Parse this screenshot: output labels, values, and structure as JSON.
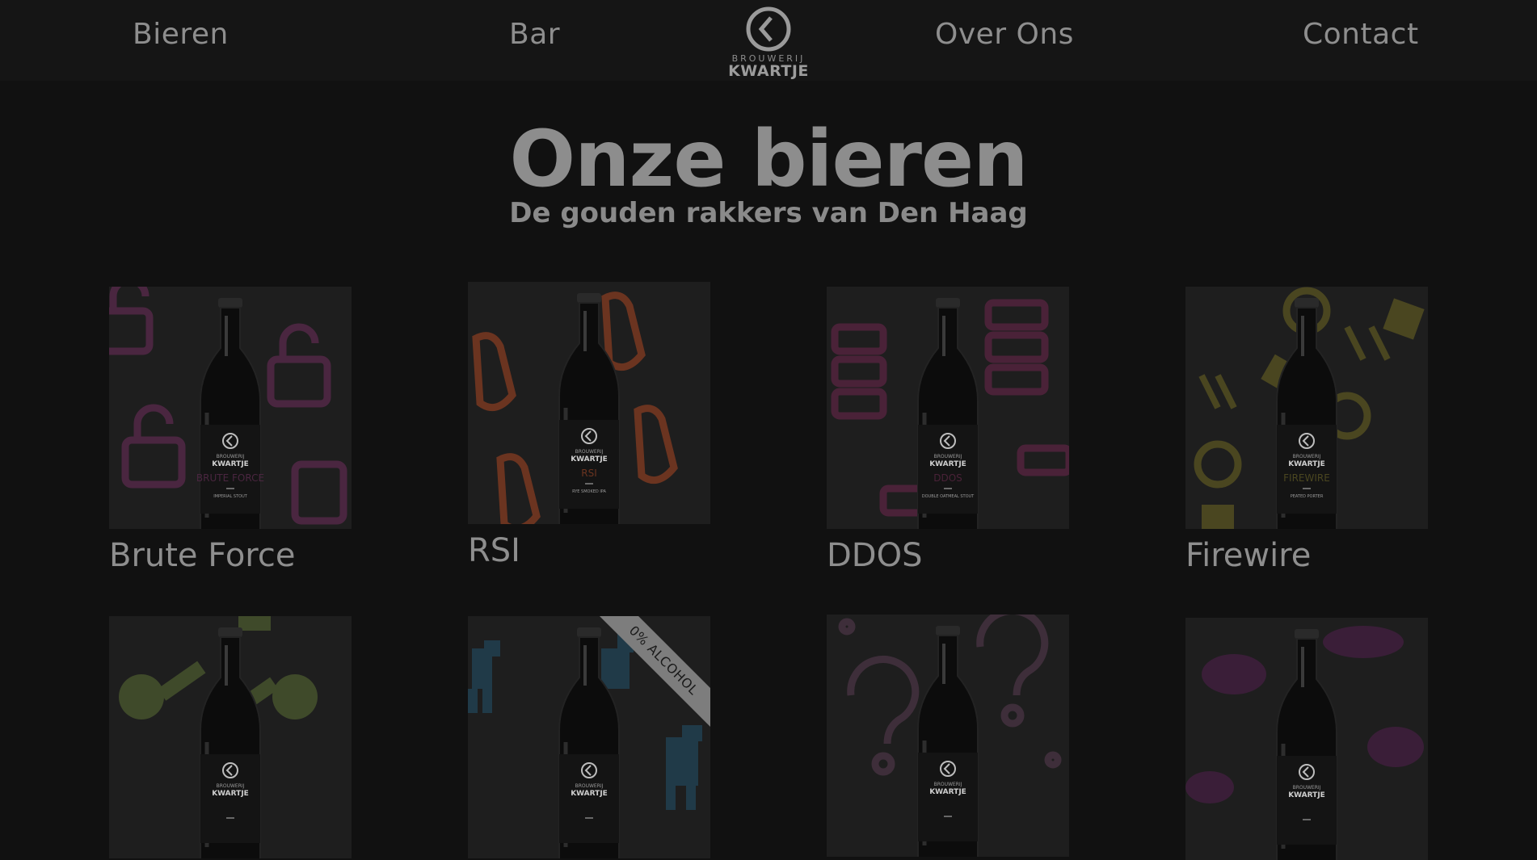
{
  "nav": {
    "links": [
      "Bieren",
      "Bar",
      "Over Ons",
      "Contact"
    ],
    "logo": {
      "top": "BROUWERIJ",
      "bottom": "KWARTJE"
    }
  },
  "hero": {
    "title": "Onze bieren",
    "subtitle": "De gouden rakkers van Den Haag"
  },
  "beers": [
    {
      "name": "Brute Force",
      "label": "BRUTE FORCE",
      "style": "IMPERIAL STOUT",
      "accent": "#4a2640"
    },
    {
      "name": "RSI",
      "label": "RSI",
      "style": "RYE SMOKED IPA",
      "accent": "#6b3420"
    },
    {
      "name": "DDOS",
      "label": "DDOS",
      "style": "DOUBLE OATMEAL STOUT",
      "accent": "#4a2238"
    },
    {
      "name": "Firewire",
      "label": "FIREWIRE",
      "style": "PEATED PORTER",
      "accent": "#4a4620"
    },
    {
      "name": "",
      "label": "",
      "style": "",
      "accent": "#3f4a2a"
    },
    {
      "name": "",
      "label": "",
      "style": "",
      "accent": "#203a48",
      "badge": "0% ALCOHOL"
    },
    {
      "name": "",
      "label": "",
      "style": "",
      "accent": "#3e2e3a"
    },
    {
      "name": "",
      "label": "",
      "style": "",
      "accent": "#3a1e38"
    }
  ],
  "bottle_logo": {
    "top": "BROUWERIJ",
    "bottom": "KWARTJE"
  }
}
